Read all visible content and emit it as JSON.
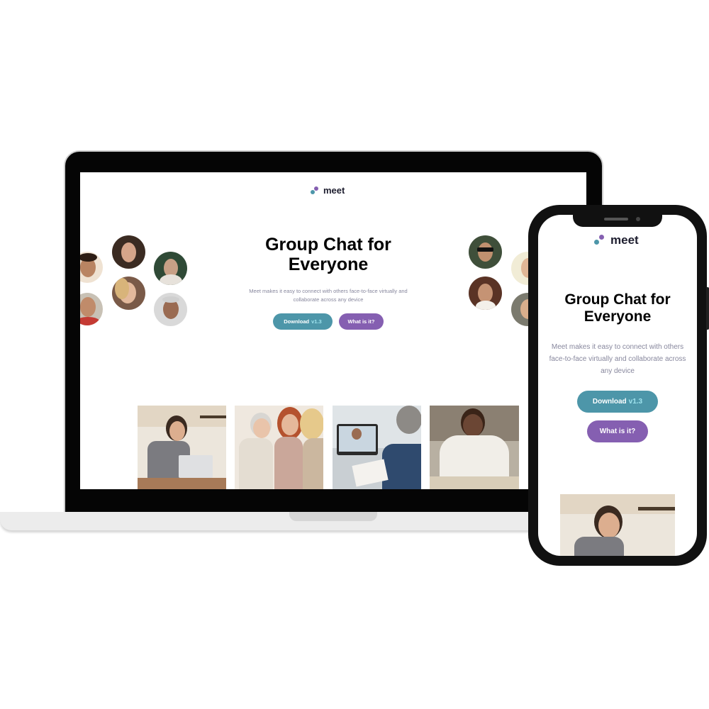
{
  "brand": {
    "name": "meet",
    "colors": {
      "teal": "#4d96a9",
      "purple": "#855fb1",
      "text": "#87879d",
      "dark": "#1e1e2f"
    }
  },
  "hero": {
    "title_line1": "Group Chat for",
    "title_line2": "Everyone",
    "description": "Meet makes it easy to connect with others face-to-face virtually and collaborate across any device"
  },
  "buttons": {
    "download_label": "Download",
    "download_version": "v1.3",
    "what_label": "What is it?"
  },
  "icons": [
    "logo-dots-icon"
  ]
}
